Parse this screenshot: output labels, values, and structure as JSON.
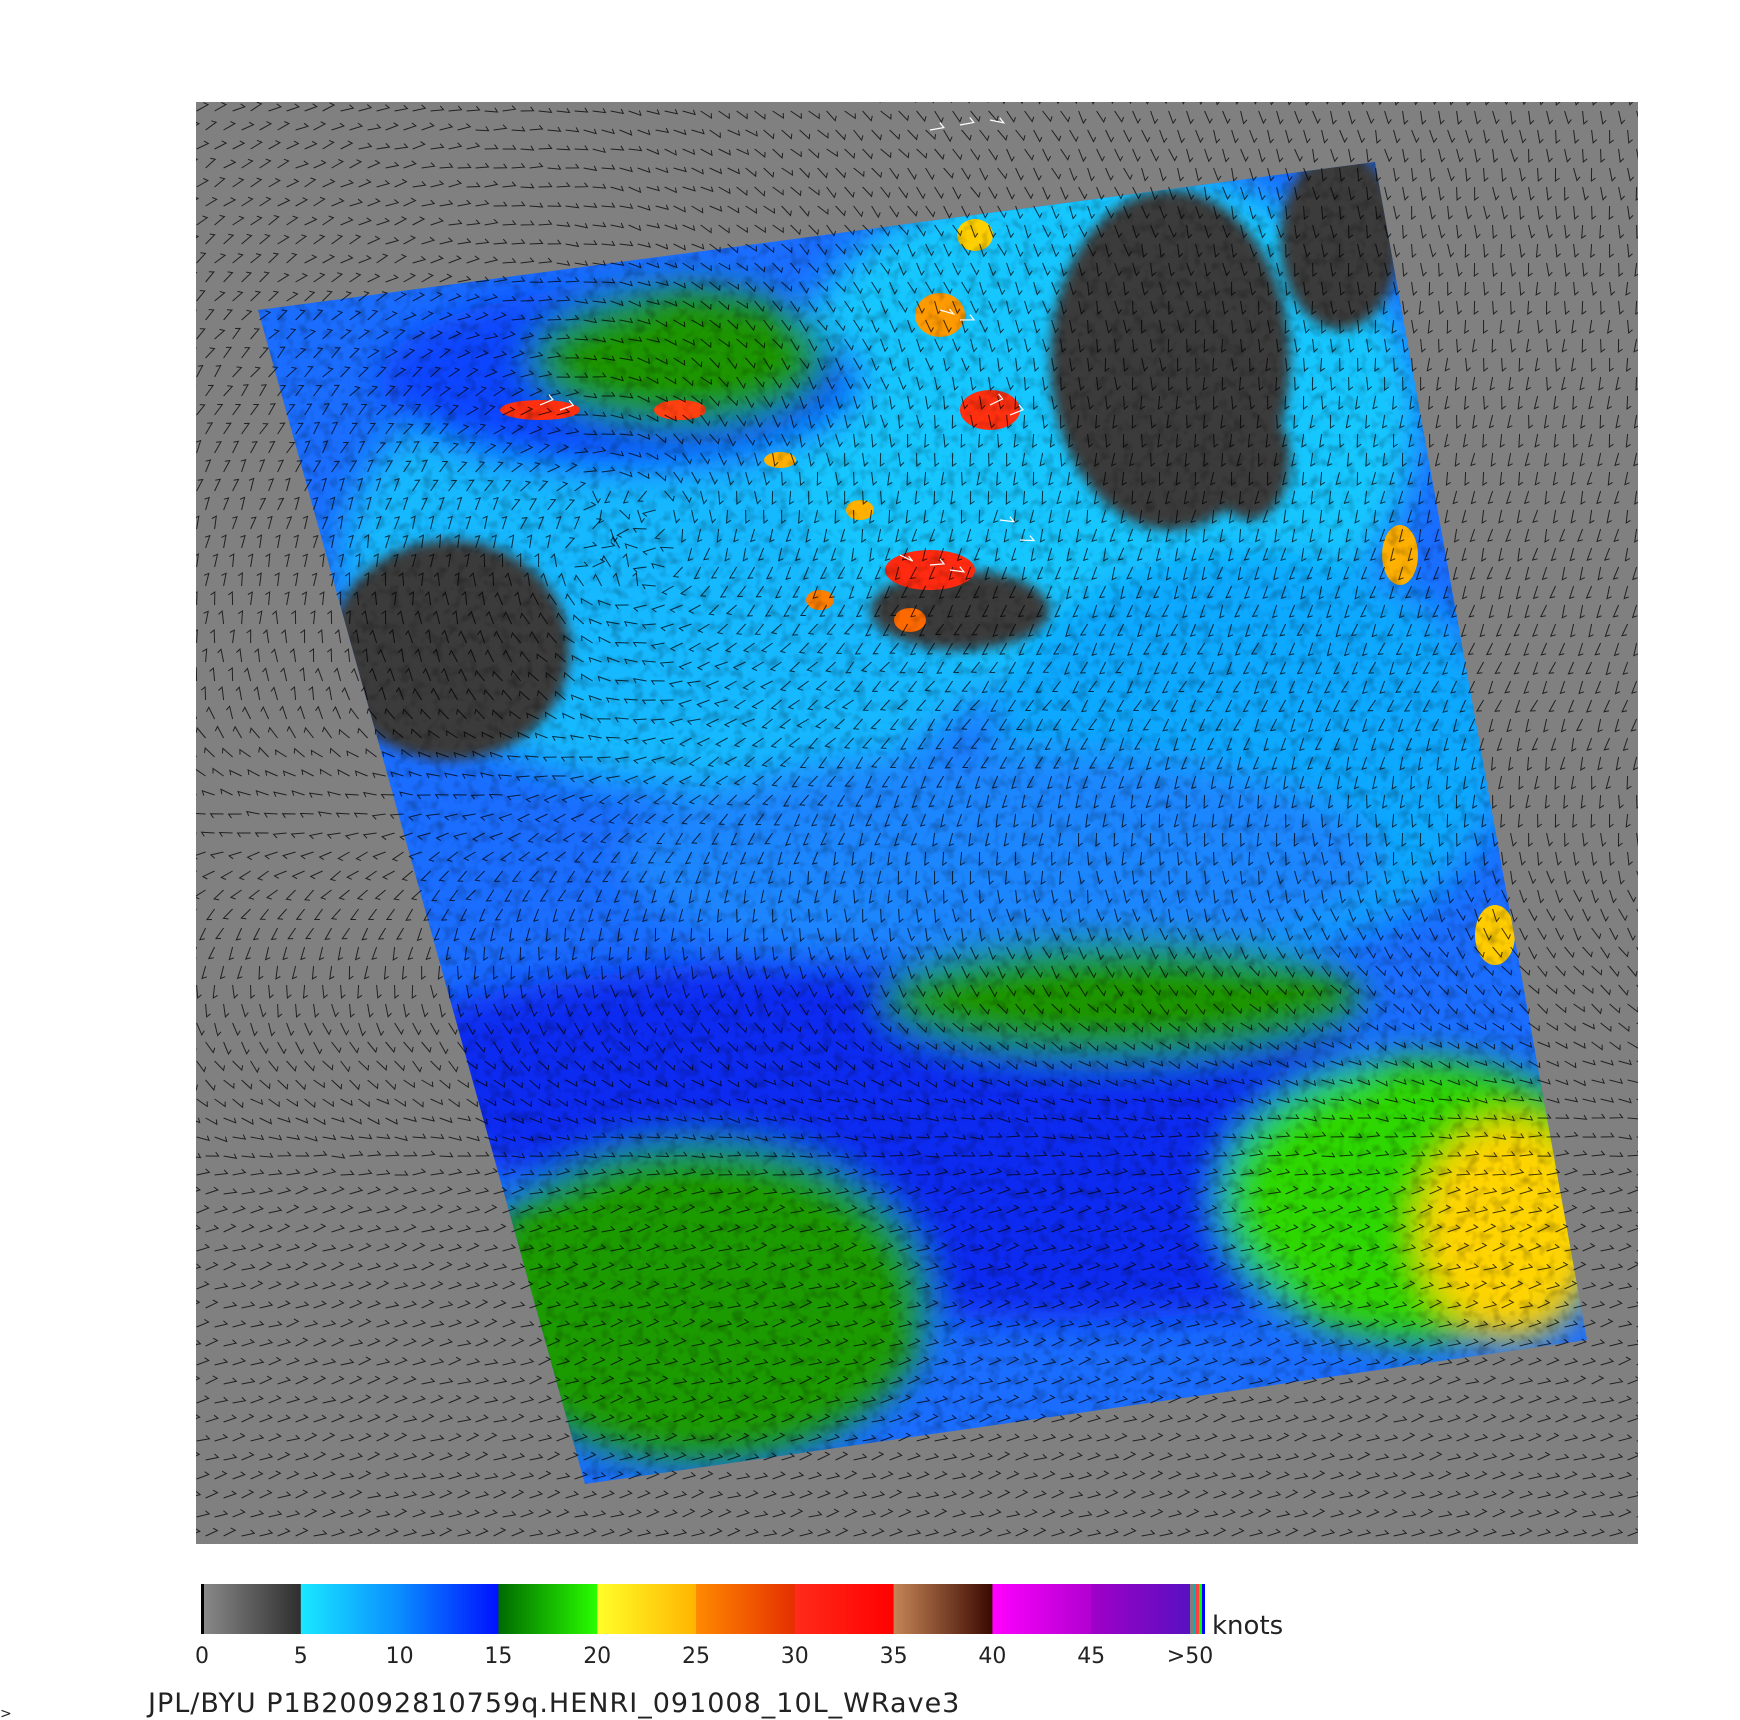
{
  "colors": {
    "background": "#ffffff",
    "land_no_data": "#808080",
    "arrow": "#000000",
    "rain_flag": "#ffffff"
  },
  "map": {
    "type": "scatterometer-wind-field",
    "swath_colors_by_region": [
      "dark-gray",
      "cyan",
      "blue",
      "green",
      "yellow",
      "red"
    ]
  },
  "colorbar": {
    "unit": "knots",
    "ticks": [
      "0",
      "5",
      "10",
      "15",
      "20",
      "25",
      "30",
      "35",
      "40",
      "45",
      ">50"
    ],
    "segments": [
      {
        "from": 0,
        "to": 5,
        "start": "#8a8a8a",
        "end": "#2e2e2e"
      },
      {
        "from": 5,
        "to": 10,
        "start": "#19e8ff",
        "end": "#0a8cff"
      },
      {
        "from": 10,
        "to": 15,
        "start": "#0a8cff",
        "end": "#0010ff"
      },
      {
        "from": 15,
        "to": 20,
        "start": "#006a00",
        "end": "#29ff00"
      },
      {
        "from": 20,
        "to": 25,
        "start": "#ffff29",
        "end": "#ffb400"
      },
      {
        "from": 25,
        "to": 30,
        "start": "#ff8a00",
        "end": "#e52e00"
      },
      {
        "from": 30,
        "to": 35,
        "start": "#ff2b1a",
        "end": "#ff0000"
      },
      {
        "from": 35,
        "to": 40,
        "start": "#c48556",
        "end": "#3a0800"
      },
      {
        "from": 40,
        "to": 45,
        "start": "#ff00ff",
        "end": "#b000d0"
      },
      {
        "from": 45,
        "to": 50,
        "start": "#a000c8",
        "end": "#5810c0"
      }
    ],
    "overflow_colors": [
      "#7f7f7f",
      "#0ab0b0",
      "#ff4040",
      "#00ff00",
      "#0000ff"
    ]
  },
  "caption": "JPL/BYU  P1B20092810759q.HENRI_091008_10L_WRave3"
}
